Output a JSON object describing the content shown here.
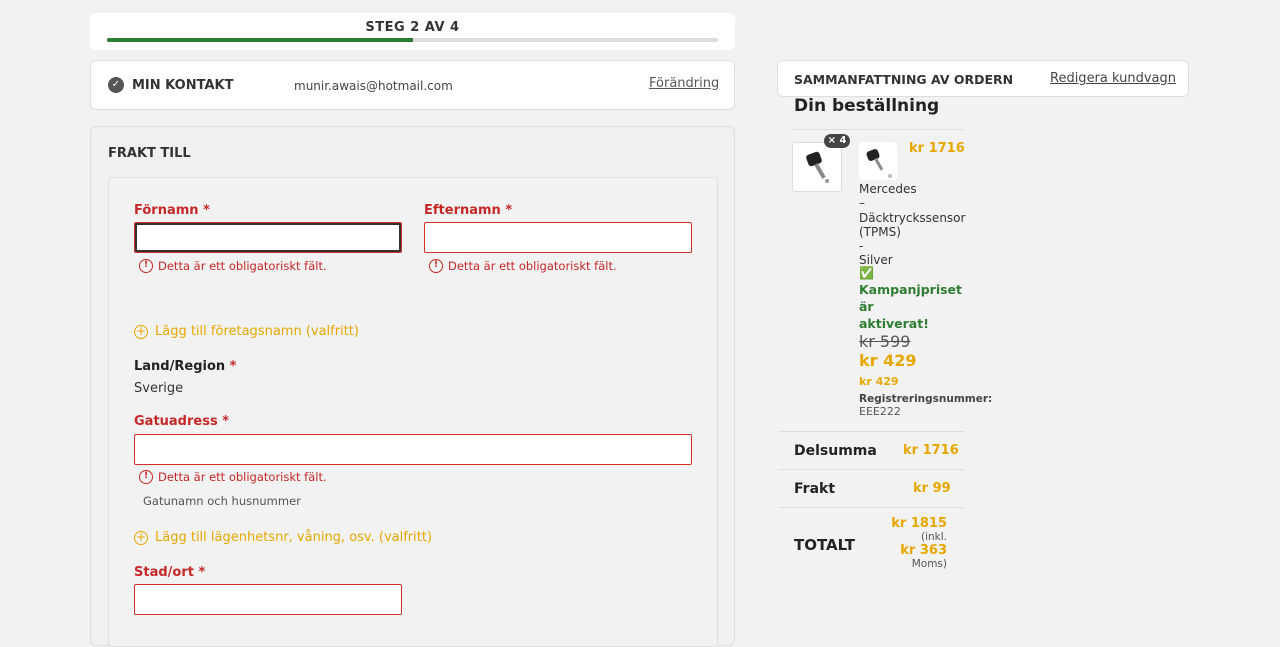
{
  "progress": {
    "label": "STEG 2 AV 4",
    "fraction": 0.5
  },
  "contact": {
    "title": "MIN KONTAKT",
    "email": "munir.awais@hotmail.com",
    "change_label": "Förändring"
  },
  "shipping": {
    "title": "FRAKT TILL",
    "first_name": {
      "label": "Förnamn",
      "required": "*",
      "value": "",
      "error": "Detta är ett obligatoriskt fält."
    },
    "last_name": {
      "label": "Efternamn",
      "required": "*",
      "value": "",
      "error": "Detta är ett obligatoriskt fält."
    },
    "add_company": "Lägg till företagsnamn (valfritt)",
    "country": {
      "label": "Land/Region",
      "required": "*",
      "value": "Sverige"
    },
    "street": {
      "label": "Gatuadress",
      "required": "*",
      "value": "",
      "error": "Detta är ett obligatoriskt fält.",
      "hint": "Gatunamn och husnummer"
    },
    "add_apartment": "Lägg till lägenhetsnr, våning, osv. (valfritt)",
    "city": {
      "label": "Stad/ort",
      "required": "*",
      "value": ""
    }
  },
  "summary": {
    "title": "SAMMANFATTNING AV ORDERN",
    "edit_cart": "Redigera kundvagn",
    "order_title": "Din beställning",
    "item": {
      "qty_badge": "× 4",
      "price": "kr 1716",
      "name_lines": [
        "Mercedes",
        "–",
        "Däcktryckssensor",
        "(TPMS)",
        "-",
        "Silver"
      ],
      "promo_icon": "✅",
      "promo_lines": [
        "Kampanjpriset",
        "är",
        "aktiverat!"
      ],
      "old_price": "kr 599",
      "new_price": "kr 429",
      "unit_price": "kr 429",
      "reg_label": "Registreringsnummer:",
      "reg_value": "EEE222"
    },
    "subtotal": {
      "label": "Delsumma",
      "value": "kr 1716"
    },
    "shipping": {
      "label": "Frakt",
      "value": "kr 99"
    },
    "total": {
      "label": "TOTALT",
      "value": "kr 1815",
      "incl": "(inkl.",
      "tax": "kr 363",
      "tax_label": "Moms)"
    }
  },
  "colors": {
    "accent": "#e6a700",
    "error": "#c62828",
    "progress": "#2e7d32"
  }
}
